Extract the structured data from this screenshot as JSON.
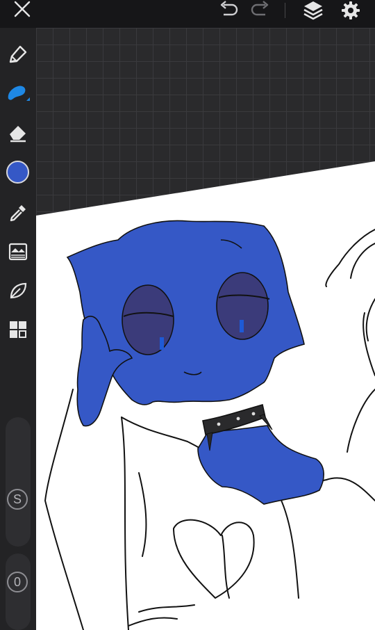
{
  "colors": {
    "accent": "#1e88e5",
    "current_color": "#3558c6",
    "toolbar_bg": "#161618",
    "sidebar_bg": "#232325",
    "canvas_bg": "#2a2a2c"
  },
  "toolbar": {
    "close_icon": "close-icon",
    "undo_icon": "undo-icon",
    "redo_icon": "redo-icon",
    "layers_icon": "layers-icon",
    "settings_icon": "gear-icon"
  },
  "sidebar": {
    "tools": [
      "pencil-tool",
      "brush-tool",
      "eraser-tool",
      "color-swatch",
      "eyedropper-tool",
      "image-adjust-tool",
      "liquify-tool",
      "gallery-tool"
    ],
    "size_label": "S",
    "opacity_label": "0"
  }
}
